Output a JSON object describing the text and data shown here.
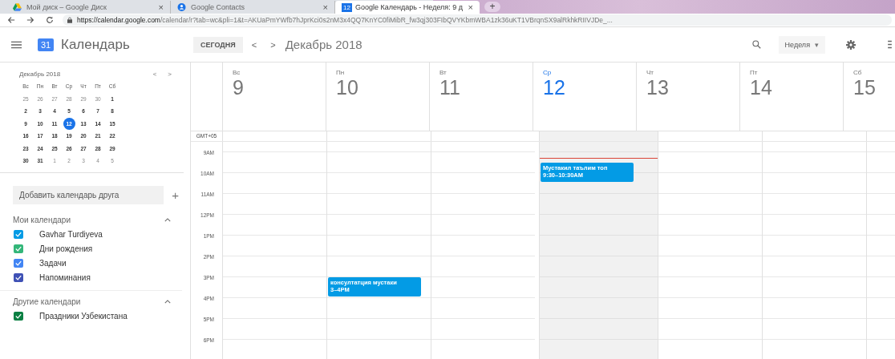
{
  "browser": {
    "tabs": [
      {
        "title": "Мой диск – Google Диск",
        "close": "×",
        "selected": false
      },
      {
        "title": "Google Contacts",
        "close": "×",
        "selected": false
      },
      {
        "title": "Google Календарь - Неделя: 9 д",
        "icon_text": "12",
        "close": "×",
        "selected": true
      }
    ],
    "new_tab": "+",
    "url_host": "https://calendar.google.com",
    "url_path": "/calendar/r?tab=wc&pli=1&t=AKUaPmYWfb7hJprKci0s2nM3x4QQ7KnYC0fiMibR_fw3qj303FIbQVYKbmWBA1zk36uKT1VBrqnSX9alRkhkRIIVJDe_..."
  },
  "header": {
    "logo_text": "31",
    "title": "Календарь",
    "today_button": "СЕГОДНЯ",
    "prev": "<",
    "next": ">",
    "period": "Декабрь 2018",
    "view": "Неделя",
    "view_caret": "▾"
  },
  "mini_calendar": {
    "title": "Декабрь 2018",
    "prev": "<",
    "next": ">",
    "weekdays": [
      "Вс",
      "Пн",
      "Вт",
      "Ср",
      "Чт",
      "Пт",
      "Сб"
    ],
    "weeks": [
      [
        {
          "d": "25",
          "muted": true,
          "selected": false
        },
        {
          "d": "26",
          "muted": true,
          "selected": false
        },
        {
          "d": "27",
          "muted": true,
          "selected": false
        },
        {
          "d": "28",
          "muted": true,
          "selected": false
        },
        {
          "d": "29",
          "muted": true,
          "selected": false
        },
        {
          "d": "30",
          "muted": true,
          "selected": false
        },
        {
          "d": "1",
          "muted": false,
          "selected": false
        }
      ],
      [
        {
          "d": "2",
          "muted": false,
          "selected": false
        },
        {
          "d": "3",
          "muted": false,
          "selected": false
        },
        {
          "d": "4",
          "muted": false,
          "selected": false
        },
        {
          "d": "5",
          "muted": false,
          "selected": false
        },
        {
          "d": "6",
          "muted": false,
          "selected": false
        },
        {
          "d": "7",
          "muted": false,
          "selected": false
        },
        {
          "d": "8",
          "muted": false,
          "selected": false
        }
      ],
      [
        {
          "d": "9",
          "muted": false,
          "selected": false
        },
        {
          "d": "10",
          "muted": false,
          "selected": false
        },
        {
          "d": "11",
          "muted": false,
          "selected": false
        },
        {
          "d": "12",
          "muted": false,
          "selected": true
        },
        {
          "d": "13",
          "muted": false,
          "selected": false
        },
        {
          "d": "14",
          "muted": false,
          "selected": false
        },
        {
          "d": "15",
          "muted": false,
          "selected": false
        }
      ],
      [
        {
          "d": "16",
          "muted": false,
          "selected": false
        },
        {
          "d": "17",
          "muted": false,
          "selected": false
        },
        {
          "d": "18",
          "muted": false,
          "selected": false
        },
        {
          "d": "19",
          "muted": false,
          "selected": false
        },
        {
          "d": "20",
          "muted": false,
          "selected": false
        },
        {
          "d": "21",
          "muted": false,
          "selected": false
        },
        {
          "d": "22",
          "muted": false,
          "selected": false
        }
      ],
      [
        {
          "d": "23",
          "muted": false,
          "selected": false
        },
        {
          "d": "24",
          "muted": false,
          "selected": false
        },
        {
          "d": "25",
          "muted": false,
          "selected": false
        },
        {
          "d": "26",
          "muted": false,
          "selected": false
        },
        {
          "d": "27",
          "muted": false,
          "selected": false
        },
        {
          "d": "28",
          "muted": false,
          "selected": false
        },
        {
          "d": "29",
          "muted": false,
          "selected": false
        }
      ],
      [
        {
          "d": "30",
          "muted": false,
          "selected": false
        },
        {
          "d": "31",
          "muted": false,
          "selected": false
        },
        {
          "d": "1",
          "muted": true,
          "selected": false
        },
        {
          "d": "2",
          "muted": true,
          "selected": false
        },
        {
          "d": "3",
          "muted": true,
          "selected": false
        },
        {
          "d": "4",
          "muted": true,
          "selected": false
        },
        {
          "d": "5",
          "muted": true,
          "selected": false
        }
      ]
    ]
  },
  "add_calendar": {
    "placeholder": "Добавить календарь друга",
    "button": "+"
  },
  "calendar_groups": [
    {
      "title": "Мои календари",
      "expanded": true,
      "items": [
        {
          "name": "Gavhar Turdiyeva",
          "checked": true,
          "color": "#039be5"
        },
        {
          "name": "Дни рождения",
          "checked": true,
          "color": "#33b679"
        },
        {
          "name": "Задачи",
          "checked": true,
          "color": "#4285f4"
        },
        {
          "name": "Напоминания",
          "checked": true,
          "color": "#3f51b5"
        }
      ]
    },
    {
      "title": "Другие календари",
      "expanded": true,
      "items": [
        {
          "name": "Праздники Узбекистана",
          "checked": true,
          "color": "#0b8043"
        }
      ]
    }
  ],
  "timezone": "GMT+05",
  "hours": [
    "9AM",
    "10AM",
    "11AM",
    "12PM",
    "1PM",
    "2PM",
    "3PM",
    "4PM",
    "5PM",
    "6PM"
  ],
  "days": [
    {
      "name": "Вс",
      "number": "9",
      "selected": false
    },
    {
      "name": "Пн",
      "number": "10",
      "selected": false,
      "events": [
        {
          "title": "консултатция мустаки",
          "time": "3–4PM"
        }
      ]
    },
    {
      "name": "Вт",
      "number": "11",
      "selected": false
    },
    {
      "name": "Ср",
      "number": "12",
      "selected": true,
      "current_time_line": true,
      "events": [
        {
          "title": "Мустакил таълим топ",
          "time": "9:30–10:30AM"
        }
      ]
    },
    {
      "name": "Чт",
      "number": "13",
      "selected": false
    },
    {
      "name": "Пт",
      "number": "14",
      "selected": false
    },
    {
      "name": "Сб",
      "number": "15",
      "selected": false
    }
  ]
}
